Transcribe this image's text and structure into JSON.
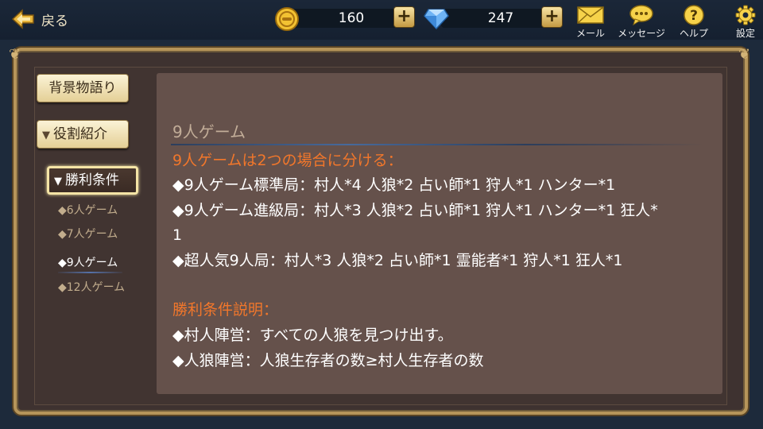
{
  "header": {
    "back_label": "戻る",
    "gold": "160",
    "diamonds": "247",
    "mail_label": "メール",
    "message_label": "メッセージ",
    "help_label": "ヘルプ",
    "settings_label": "設定"
  },
  "sidebar": {
    "story_label": "背景物語り",
    "roles_label": "役割紹介",
    "victory_label": "勝利条件",
    "sub_items": [
      "◆6人ゲーム",
      "◆7人ゲーム",
      "◆9人ゲーム",
      "◆12人ゲーム"
    ],
    "active_sub_item": "◆9人ゲーム"
  },
  "content": {
    "title": "9人ゲーム",
    "heading1": "9人ゲームは2つの場合に分ける：",
    "line1": "◆9人ゲーム標準局：村人*4 人狼*2 占い師*1 狩人*1 ハンター*1",
    "line2a": "◆9人ゲーム進級局：村人*3 人狼*2 占い師*1 狩人*1 ハンター*1 狂人*",
    "line2b": "1",
    "line3": "◆超人気9人局：村人*3 人狼*2 占い師*1 霊能者*1 狩人*1 狂人*1",
    "heading2": "勝利条件説明：",
    "line4": "◆村人陣営：すべての人狼を見つけ出す。",
    "line5": "◆人狼陣営：人狼生存者の数≥村人生存者の数"
  },
  "colors": {
    "highlight": "#f2772b",
    "panel": "#65514b",
    "frame_gold": "#b6955a"
  },
  "icons": [
    "back-arrow-icon",
    "gold-coin-icon",
    "diamond-icon",
    "plus-icon",
    "mail-icon",
    "message-icon",
    "help-icon",
    "settings-gear-icon",
    "chevron-down-icon"
  ]
}
